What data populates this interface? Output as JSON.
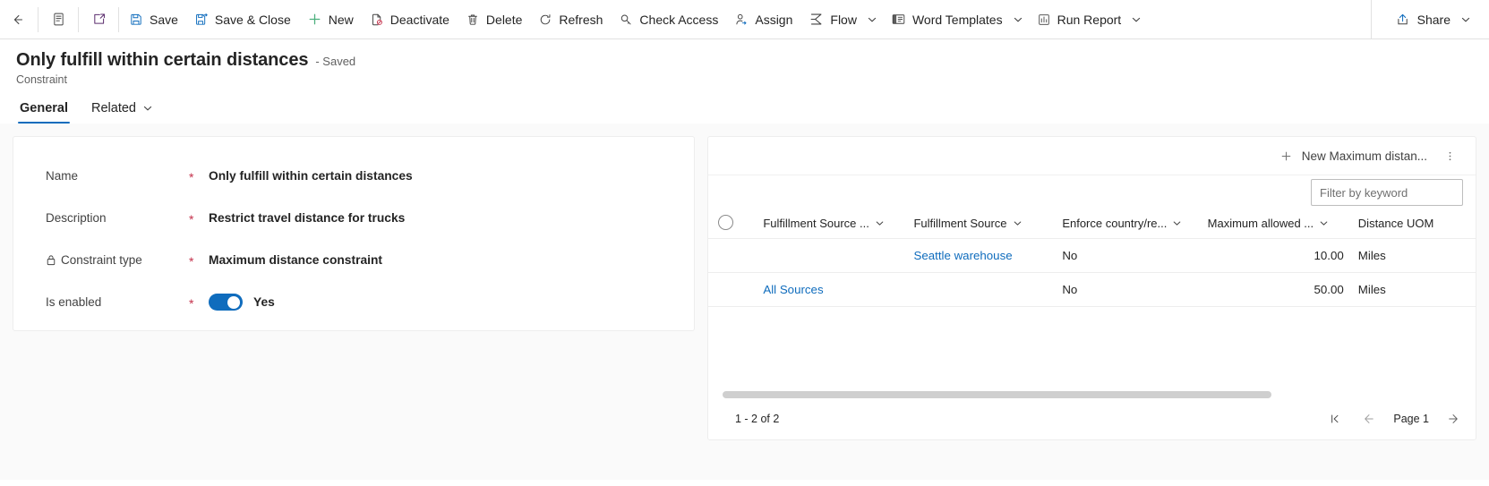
{
  "commandbar": {
    "back_icon": "back-arrow-icon",
    "form_icon": "form-icon",
    "popout_icon": "pop-out-icon",
    "items": [
      {
        "id": "save",
        "label": "Save",
        "icon": "save-icon"
      },
      {
        "id": "save-close",
        "label": "Save & Close",
        "icon": "save-and-close-icon"
      },
      {
        "id": "new",
        "label": "New",
        "icon": "plus-icon"
      },
      {
        "id": "deactivate",
        "label": "Deactivate",
        "icon": "deactivate-icon"
      },
      {
        "id": "delete",
        "label": "Delete",
        "icon": "trash-icon"
      },
      {
        "id": "refresh",
        "label": "Refresh",
        "icon": "refresh-icon"
      },
      {
        "id": "check-access",
        "label": "Check Access",
        "icon": "key-icon"
      },
      {
        "id": "assign",
        "label": "Assign",
        "icon": "person-assign-icon"
      },
      {
        "id": "flow",
        "label": "Flow",
        "icon": "flow-icon",
        "chevron": true
      },
      {
        "id": "word-templates",
        "label": "Word Templates",
        "icon": "word-template-icon",
        "chevron": true
      },
      {
        "id": "run-report",
        "label": "Run Report",
        "icon": "report-icon",
        "chevron": true
      }
    ],
    "share": {
      "label": "Share",
      "icon": "share-icon",
      "chevron": true
    }
  },
  "header": {
    "title": "Only fulfill within certain distances",
    "saved_state": "- Saved",
    "entity": "Constraint",
    "tabs": [
      {
        "id": "general",
        "label": "General",
        "active": true,
        "chevron": false
      },
      {
        "id": "related",
        "label": "Related",
        "active": false,
        "chevron": true
      }
    ]
  },
  "form": {
    "fields": [
      {
        "label": "Name",
        "required": "*",
        "value": "Only fulfill within certain distances",
        "locked": false,
        "type": "text"
      },
      {
        "label": "Description",
        "required": "*",
        "value": "Restrict travel distance for trucks",
        "locked": false,
        "type": "text"
      },
      {
        "label": "Constraint type",
        "required": "*",
        "value": "Maximum distance constraint",
        "locked": true,
        "type": "text"
      },
      {
        "label": "Is enabled",
        "required": "*",
        "value": "Yes",
        "locked": false,
        "type": "toggle",
        "toggle_on": true
      }
    ]
  },
  "subgrid": {
    "new_button": {
      "label": "New Maximum distan...",
      "icon": "plus-icon"
    },
    "more_icon": "more-vertical-icon",
    "filter": {
      "placeholder": "Filter by keyword",
      "value": ""
    },
    "columns": [
      {
        "id": "select",
        "label": "",
        "sortable": false,
        "align": "left"
      },
      {
        "id": "fulfillment-source-type",
        "label": "Fulfillment Source ...",
        "sortable": true,
        "align": "left"
      },
      {
        "id": "fulfillment-source",
        "label": "Fulfillment Source",
        "sortable": true,
        "align": "left"
      },
      {
        "id": "enforce-country",
        "label": "Enforce country/re...",
        "sortable": true,
        "align": "left"
      },
      {
        "id": "maximum-allowed",
        "label": "Maximum allowed ...",
        "sortable": true,
        "align": "right"
      },
      {
        "id": "distance-uom",
        "label": "Distance UOM",
        "sortable": false,
        "align": "left"
      }
    ],
    "rows": [
      {
        "fulfillment_source_type": "",
        "fulfillment_source": "Seattle warehouse",
        "fulfillment_source_is_link": true,
        "enforce_country": "No",
        "maximum_allowed": "10.00",
        "distance_uom": "Miles"
      },
      {
        "fulfillment_source_type": "All Sources",
        "fulfillment_source": "",
        "fulfillment_source_is_link": false,
        "enforce_country": "No",
        "maximum_allowed": "50.00",
        "distance_uom": "Miles"
      }
    ],
    "footer": {
      "count": "1 - 2 of 2",
      "page_label": "Page 1",
      "first_icon": "first-page-icon",
      "prev_icon": "previous-page-icon",
      "next_icon": "next-page-icon"
    }
  },
  "colors": {
    "accent": "#0f6cbd",
    "link": "#0f6cbd",
    "required": "#c4314b",
    "toggle_on": "#0f6cbd",
    "new_green": "#4caf7d",
    "body_bg": "#fafafa"
  }
}
